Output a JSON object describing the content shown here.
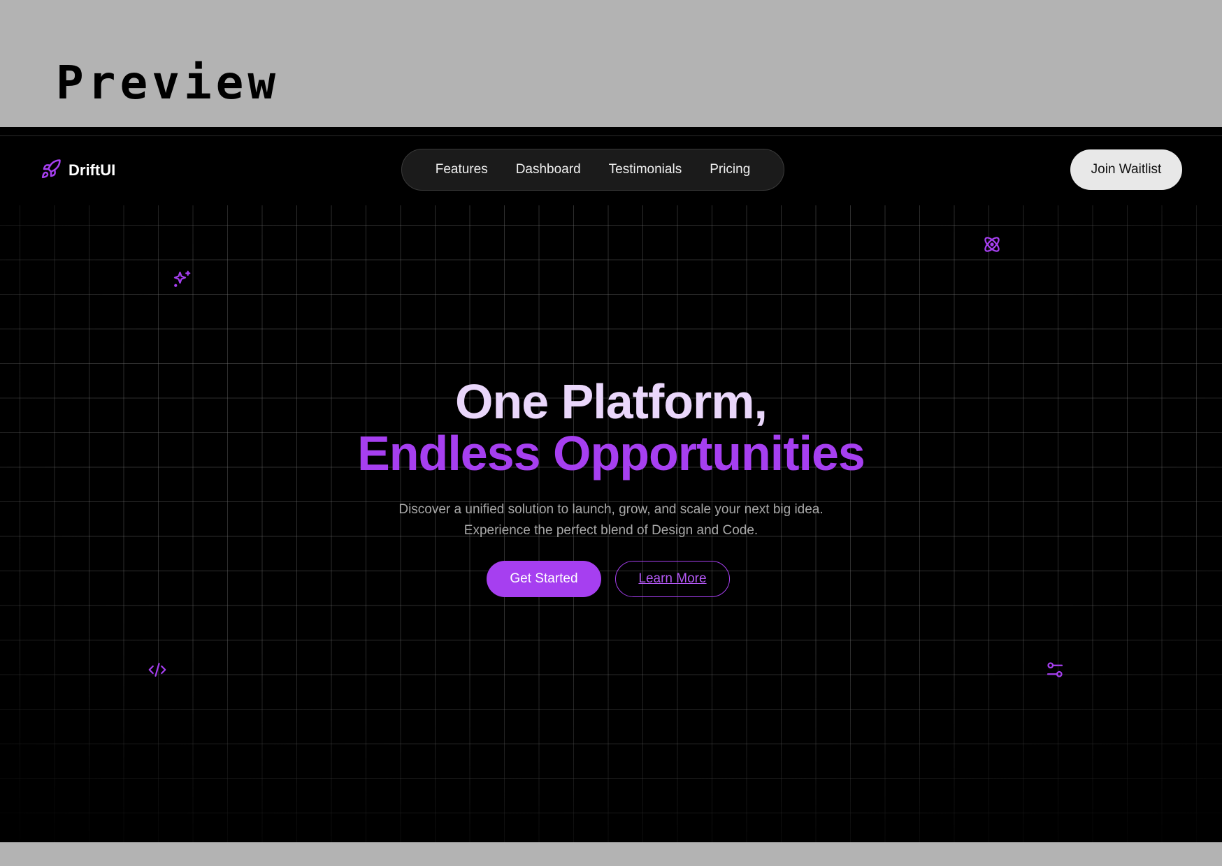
{
  "banner": {
    "title": "Preview"
  },
  "brand": {
    "name": "DriftUI",
    "icon": "rocket-icon",
    "accent": "#a63ff0"
  },
  "nav": {
    "links": [
      "Features",
      "Dashboard",
      "Testimonials",
      "Pricing"
    ],
    "cta": "Join Waitlist"
  },
  "hero": {
    "line1": "One Platform,",
    "line2": "Endless Opportunities",
    "subtitle_1": "Discover a unified solution to launch, grow, and scale your next big idea.",
    "subtitle_2": "Experience the perfect blend of Design and Code.",
    "primary_button": "Get Started",
    "secondary_button": "Learn More"
  },
  "decor_icons": [
    "sparkles-icon",
    "atom-icon",
    "code-icon",
    "sliders-icon"
  ],
  "colors": {
    "background": "#000000",
    "heading_light": "#ead7fb",
    "heading_accent": "#a63ff0",
    "subtitle": "#a8a8a8",
    "nav_pill": "#1b1b1b",
    "cta_bg": "#e8e8e8"
  }
}
